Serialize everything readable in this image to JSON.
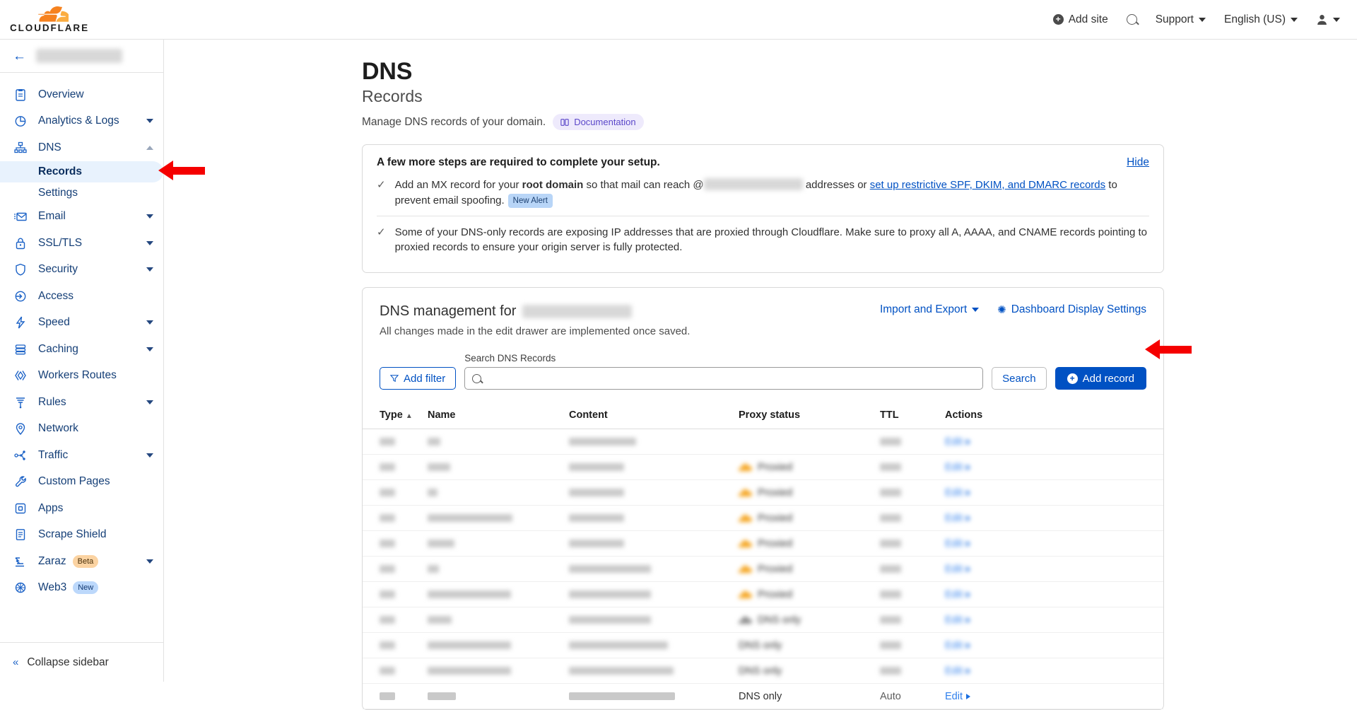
{
  "topbar": {
    "logo_text": "CLOUDFLARE",
    "add_site": "Add site",
    "search_icon": "search-icon",
    "support": "Support",
    "language": "English (US)",
    "account_icon": "user-icon"
  },
  "sidebar": {
    "zone_name_redacted": "",
    "items": [
      {
        "label": "Overview",
        "icon": "clipboard-icon",
        "expandable": false
      },
      {
        "label": "Analytics & Logs",
        "icon": "pie-chart-icon",
        "expandable": true
      },
      {
        "label": "DNS",
        "icon": "sitemap-icon",
        "expandable": true,
        "expanded": true
      },
      {
        "label": "Email",
        "icon": "envelope-icon",
        "expandable": true
      },
      {
        "label": "SSL/TLS",
        "icon": "lock-icon",
        "expandable": true
      },
      {
        "label": "Security",
        "icon": "shield-icon",
        "expandable": true
      },
      {
        "label": "Access",
        "icon": "access-arrow-icon",
        "expandable": false
      },
      {
        "label": "Speed",
        "icon": "bolt-icon",
        "expandable": true
      },
      {
        "label": "Caching",
        "icon": "database-icon",
        "expandable": true
      },
      {
        "label": "Workers Routes",
        "icon": "workers-icon",
        "expandable": false
      },
      {
        "label": "Rules",
        "icon": "funnel-icon",
        "expandable": true
      },
      {
        "label": "Network",
        "icon": "pin-icon",
        "expandable": false
      },
      {
        "label": "Traffic",
        "icon": "traffic-icon",
        "expandable": true
      },
      {
        "label": "Custom Pages",
        "icon": "wrench-icon",
        "expandable": false
      },
      {
        "label": "Apps",
        "icon": "apps-icon",
        "expandable": false
      },
      {
        "label": "Scrape Shield",
        "icon": "document-icon",
        "expandable": false
      },
      {
        "label": "Zaraz",
        "icon": "zaraz-icon",
        "expandable": true,
        "badge": "Beta",
        "badge_type": "beta"
      },
      {
        "label": "Web3",
        "icon": "web3-icon",
        "expandable": false,
        "badge": "New",
        "badge_type": "new"
      }
    ],
    "dns_sub_items": [
      {
        "label": "Records",
        "active": true
      },
      {
        "label": "Settings",
        "active": false
      }
    ],
    "collapse": "Collapse sidebar"
  },
  "page": {
    "title": "DNS",
    "subtitle": "Records",
    "description": "Manage DNS records of your domain.",
    "documentation_badge": "Documentation"
  },
  "alert": {
    "title": "A few more steps are required to complete your setup.",
    "hide_label": "Hide",
    "items": [
      {
        "text_before_bold": "Add an MX record for your ",
        "bold": "root domain",
        "text_after_bold": " so that mail can reach @",
        "text_after_redaction": " addresses or ",
        "link": "set up restrictive SPF, DKIM, and DMARC records",
        "text_tail": " to prevent email spoofing.",
        "badge": "New Alert"
      },
      {
        "text": "Some of your DNS-only records are exposing IP addresses that are proxied through Cloudflare. Make sure to proxy all A, AAAA, and CNAME records pointing to proxied records to ensure your origin server is fully protected."
      }
    ]
  },
  "management": {
    "heading_prefix": "DNS management for",
    "subheading": "All changes made in the edit drawer are implemented once saved.",
    "import_export": "Import and Export",
    "display_settings": "Dashboard Display Settings",
    "add_filter": "Add filter",
    "search_label": "Search DNS Records",
    "search_value": "",
    "search_placeholder": "",
    "search_button": "Search",
    "add_record": "Add record"
  },
  "table": {
    "columns": [
      "Type",
      "Name",
      "Content",
      "Proxy status",
      "TTL",
      "Actions"
    ],
    "sort_column": "Type",
    "sort_direction": "asc",
    "rows": [
      {
        "proxy_status": "",
        "proxy_icon": "none",
        "edit": "Edit",
        "redacted": true,
        "name_w": 18,
        "content_w": 95,
        "ttl_w": 30
      },
      {
        "proxy_status": "Proxied",
        "proxy_icon": "cloud-orange",
        "edit": "Edit",
        "redacted": true,
        "name_w": 32,
        "content_w": 78,
        "ttl_w": 30
      },
      {
        "proxy_status": "Proxied",
        "proxy_icon": "cloud-orange",
        "edit": "Edit",
        "redacted": true,
        "name_w": 14,
        "content_w": 78,
        "ttl_w": 30
      },
      {
        "proxy_status": "Proxied",
        "proxy_icon": "cloud-orange",
        "edit": "Edit",
        "redacted": true,
        "name_w": 120,
        "content_w": 78,
        "ttl_w": 30
      },
      {
        "proxy_status": "Proxied",
        "proxy_icon": "cloud-orange",
        "edit": "Edit",
        "redacted": true,
        "name_w": 38,
        "content_w": 78,
        "ttl_w": 30
      },
      {
        "proxy_status": "Proxied",
        "proxy_icon": "cloud-orange",
        "edit": "Edit",
        "redacted": true,
        "name_w": 16,
        "content_w": 116,
        "ttl_w": 30
      },
      {
        "proxy_status": "Proxied",
        "proxy_icon": "cloud-orange",
        "edit": "Edit",
        "redacted": true,
        "name_w": 118,
        "content_w": 116,
        "ttl_w": 30
      },
      {
        "proxy_status": "DNS only",
        "proxy_icon": "cloud-grey",
        "edit": "Edit",
        "redacted": true,
        "name_w": 34,
        "content_w": 116,
        "ttl_w": 30
      },
      {
        "proxy_status": "DNS only",
        "proxy_icon": "none",
        "edit": "Edit",
        "redacted": true,
        "name_w": 118,
        "content_w": 140,
        "ttl_w": 30
      },
      {
        "proxy_status": "DNS only",
        "proxy_icon": "none",
        "edit": "Edit",
        "redacted": true,
        "name_w": 118,
        "content_w": 148,
        "ttl_w": 30
      },
      {
        "proxy_status": "DNS only",
        "proxy_icon": "none",
        "edit": "Edit",
        "redacted": false,
        "ttl": "Auto",
        "name_w": 40,
        "content_w": 150,
        "ttl_w": 30
      }
    ]
  },
  "annotations": {
    "arrow_records": "points-at-records-sidebar-item",
    "arrow_add_record": "points-at-add-record-button"
  },
  "colors": {
    "brand_orange": "#f6821f",
    "link_blue": "#0051c3",
    "primary_button": "#0051c3",
    "annotation_red": "#f50000",
    "nav_text": "#153f77",
    "proxied_cloud": "#f5a623",
    "dns_only_cloud": "#8e8e8e"
  }
}
